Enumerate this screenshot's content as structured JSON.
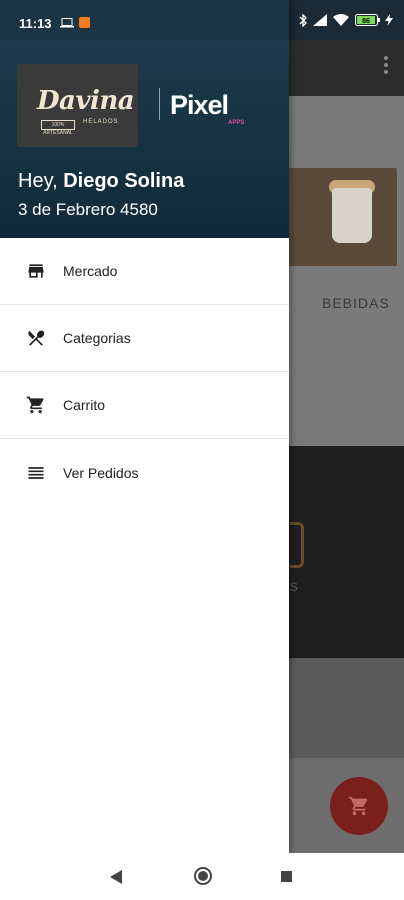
{
  "status_bar": {
    "time": "11:13",
    "battery": "86"
  },
  "background": {
    "category_label": "BEBIDAS",
    "fragment_text": "s"
  },
  "drawer": {
    "header": {
      "brand_logo_text": "Davina",
      "brand_logo_subtext": "HELADOS",
      "brand_logo_badge": "100% ARTESANAL",
      "partner_logo_text": "Pixel",
      "partner_logo_subtext": "APPS",
      "greeting_prefix": "Hey, ",
      "user_name": "Diego Solina",
      "address": "3 de Febrero 4580"
    },
    "menu": [
      {
        "label": "Mercado",
        "icon": "store-icon"
      },
      {
        "label": "Categorias",
        "icon": "utensils-icon"
      },
      {
        "label": "Carrito",
        "icon": "cart-icon"
      },
      {
        "label": "Ver Pedidos",
        "icon": "list-icon"
      }
    ]
  },
  "colors": {
    "header_bg": "#1c3a4a",
    "fab": "#7a1f1a",
    "notification": "#f57c1f"
  }
}
